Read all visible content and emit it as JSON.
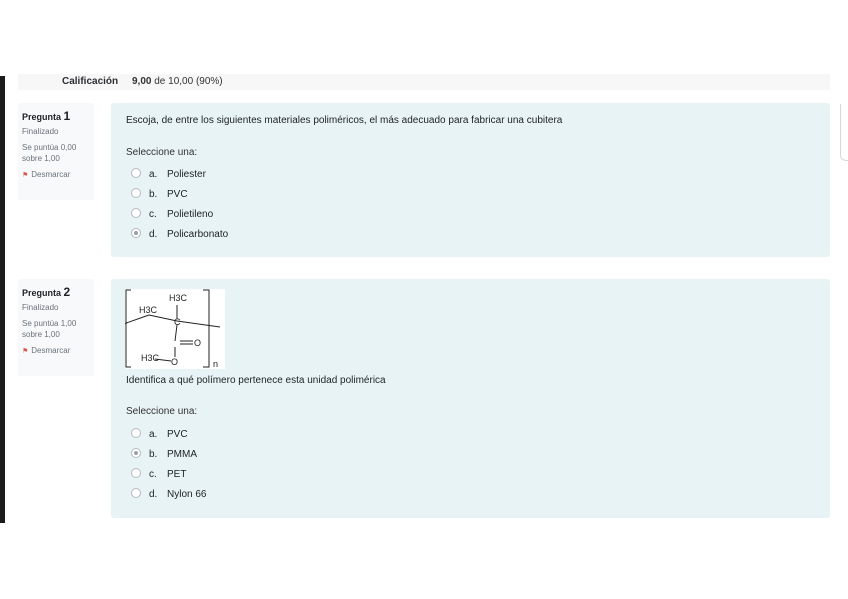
{
  "summary": {
    "grade_label": "Calificación",
    "grade_value": "9,00",
    "grade_rest": "de 10,00 (90%)"
  },
  "questions": [
    {
      "title": "Pregunta",
      "number": "1",
      "state": "Finalizado",
      "score_line1": "Se puntúa 0,00",
      "score_line2": "sobre 1,00",
      "flag_label": "Desmarcar",
      "text": "Escoja, de entre los siguientes materiales poliméricos, el más adecuado para fabricar una cubitera",
      "prompt": "Seleccione una:",
      "options": [
        {
          "letter": "a.",
          "label": "Poliester",
          "selected": false
        },
        {
          "letter": "b.",
          "label": "PVC",
          "selected": false
        },
        {
          "letter": "c.",
          "label": "Polietileno",
          "selected": false
        },
        {
          "letter": "d.",
          "label": "Policarbonato",
          "selected": true
        }
      ]
    },
    {
      "title": "Pregunta",
      "number": "2",
      "state": "Finalizado",
      "score_line1": "Se puntúa 1,00",
      "score_line2": "sobre 1,00",
      "flag_label": "Desmarcar",
      "formula_labels": {
        "h3c_top": "H3C",
        "h3c_left": "H3C",
        "h3c_bottom": "H3C",
        "c": "C",
        "o_dbl": "O",
        "o": "O",
        "n": "n"
      },
      "text": "Identifica a qué polímero pertenece esta unidad polimérica",
      "prompt": "Seleccione una:",
      "options": [
        {
          "letter": "a.",
          "label": "PVC",
          "selected": false
        },
        {
          "letter": "b.",
          "label": "PMMA",
          "selected": true
        },
        {
          "letter": "c.",
          "label": "PET",
          "selected": false
        },
        {
          "letter": "d.",
          "label": "Nylon 66",
          "selected": false
        }
      ]
    }
  ]
}
